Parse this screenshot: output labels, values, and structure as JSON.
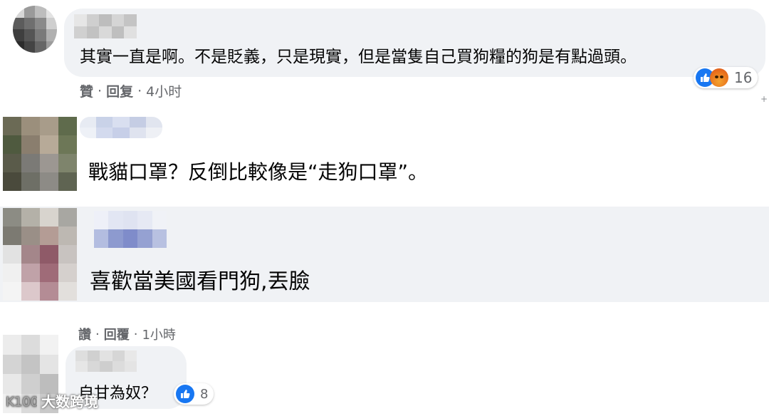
{
  "comments": [
    {
      "text": "其實一直是啊。不是貶義，只是現實，但是當隻自己買狗糧的狗是有點過頭。",
      "actions": {
        "like": "贊",
        "reply": "回复",
        "time": "4小时"
      },
      "reactions": {
        "types": [
          "like-icon",
          "angry-icon"
        ],
        "count": "16"
      }
    },
    {
      "text": "戰貓口罩？反倒比較像是“走狗口罩”。"
    },
    {
      "text": "喜歡當美國看門狗,丟臉"
    },
    {
      "actions": {
        "like": "讚",
        "reply": "回覆",
        "time": "1小時"
      },
      "text": "自甘為奴？",
      "reactions": {
        "types": [
          "like-icon"
        ],
        "count": "8"
      }
    }
  ],
  "watermark": {
    "text": "大数跨境"
  },
  "colors": {
    "bubble": "#f0f2f5",
    "meta": "#65676b",
    "like": "#1877f2"
  }
}
